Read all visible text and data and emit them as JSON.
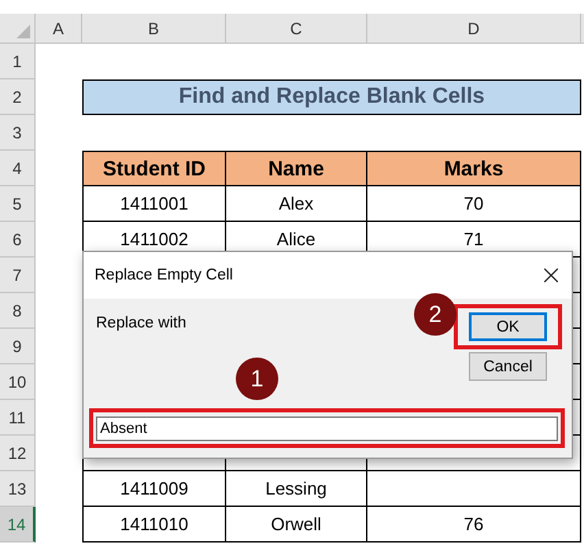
{
  "columns": [
    "A",
    "B",
    "C",
    "D"
  ],
  "rows": [
    {
      "label": "1",
      "selected": false,
      "kind": "blank"
    },
    {
      "label": "2",
      "selected": false,
      "kind": "title",
      "text": "Find and Replace Blank Cells"
    },
    {
      "label": "3",
      "selected": false,
      "kind": "blank"
    },
    {
      "label": "4",
      "selected": false,
      "kind": "header",
      "cells": [
        "Student ID",
        "Name",
        "Marks"
      ]
    },
    {
      "label": "5",
      "selected": false,
      "kind": "data",
      "cells": [
        "1411001",
        "Alex",
        "70"
      ]
    },
    {
      "label": "6",
      "selected": false,
      "kind": "data",
      "cells": [
        "1411002",
        "Alice",
        "71"
      ]
    },
    {
      "label": "7",
      "selected": false,
      "kind": "covered"
    },
    {
      "label": "8",
      "selected": false,
      "kind": "covered"
    },
    {
      "label": "9",
      "selected": false,
      "kind": "covered"
    },
    {
      "label": "10",
      "selected": false,
      "kind": "covered"
    },
    {
      "label": "11",
      "selected": false,
      "kind": "covered"
    },
    {
      "label": "12",
      "selected": false,
      "kind": "covered"
    },
    {
      "label": "13",
      "selected": false,
      "kind": "data",
      "cells": [
        "1411009",
        "Lessing",
        null
      ]
    },
    {
      "label": "14",
      "selected": true,
      "kind": "data",
      "cells": [
        "1411010",
        "Orwell",
        "76"
      ]
    }
  ],
  "dialog": {
    "title": "Replace Empty Cell",
    "label": "Replace with",
    "value": "Absent",
    "field_highlighted": true,
    "buttons": [
      {
        "label": "OK",
        "default": true,
        "highlighted": true
      },
      {
        "label": "Cancel",
        "default": false,
        "highlighted": false
      }
    ]
  },
  "callouts": [
    {
      "label": "1"
    },
    {
      "label": "2"
    }
  ]
}
